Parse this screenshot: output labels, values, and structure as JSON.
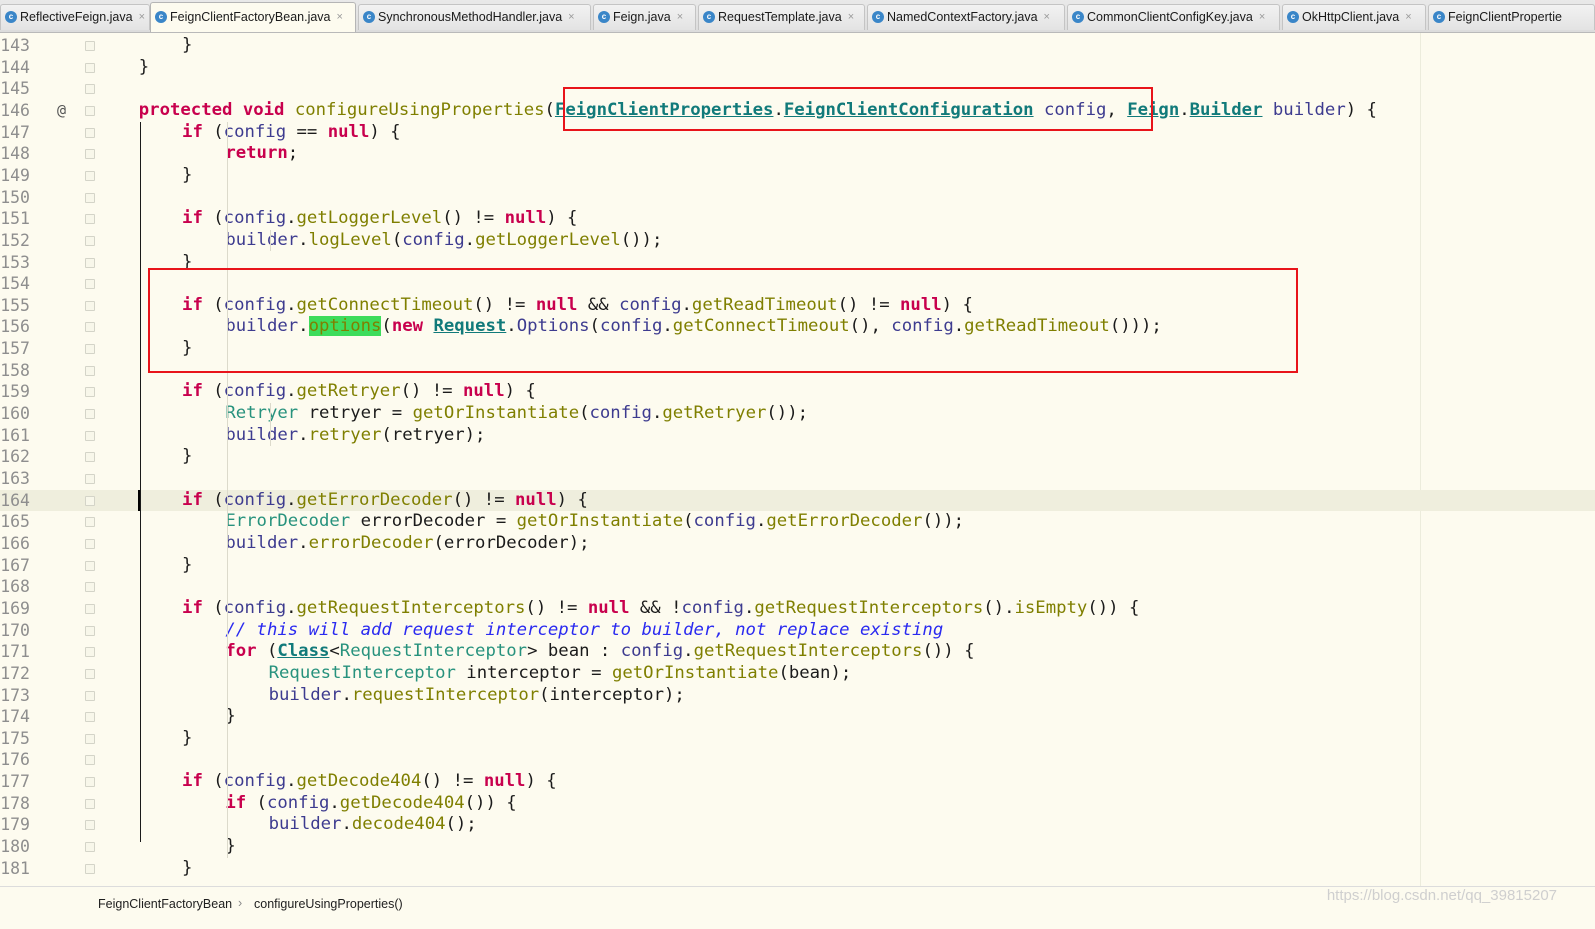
{
  "tabs": [
    {
      "label": "ReflectiveFeign.java",
      "active": false
    },
    {
      "label": "FeignClientFactoryBean.java",
      "active": true
    },
    {
      "label": "SynchronousMethodHandler.java",
      "active": false
    },
    {
      "label": "Feign.java",
      "active": false
    },
    {
      "label": "RequestTemplate.java",
      "active": false
    },
    {
      "label": "NamedContextFactory.java",
      "active": false
    },
    {
      "label": "CommonClientConfigKey.java",
      "active": false
    },
    {
      "label": "OkHttpClient.java",
      "active": false
    },
    {
      "label": "FeignClientPropertie",
      "active": false
    }
  ],
  "tab_icon": "class-icon",
  "tab_icon_glyph": "c",
  "tab_close_glyph": "×",
  "gutter": {
    "override_marker": "@",
    "override_marker_line": 146
  },
  "current_line": 164,
  "code_lines": [
    {
      "n": 143,
      "indent": 8,
      "tokens": [
        {
          "t": "}"
        }
      ]
    },
    {
      "n": 144,
      "indent": 4,
      "tokens": [
        {
          "t": "}"
        }
      ]
    },
    {
      "n": 145,
      "indent": 0,
      "tokens": []
    },
    {
      "n": 146,
      "indent": 4,
      "tokens": [
        {
          "t": "protected",
          "c": "kw"
        },
        {
          "t": " "
        },
        {
          "t": "void",
          "c": "kw"
        },
        {
          "t": " "
        },
        {
          "t": "configureUsingProperties",
          "c": "m"
        },
        {
          "t": "("
        },
        {
          "t": "FeignClientProperties",
          "c": "tl"
        },
        {
          "t": "."
        },
        {
          "t": "FeignClientConfiguration",
          "c": "tl"
        },
        {
          "t": " "
        },
        {
          "t": "config",
          "c": "v"
        },
        {
          "t": ", "
        },
        {
          "t": "Feign",
          "c": "tl"
        },
        {
          "t": "."
        },
        {
          "t": "Builder",
          "c": "tl"
        },
        {
          "t": " "
        },
        {
          "t": "builder",
          "c": "v"
        },
        {
          "t": ") {"
        }
      ]
    },
    {
      "n": 147,
      "indent": 8,
      "tokens": [
        {
          "t": "if",
          "c": "kw"
        },
        {
          "t": " ("
        },
        {
          "t": "config",
          "c": "v"
        },
        {
          "t": " == "
        },
        {
          "t": "null",
          "c": "kw"
        },
        {
          "t": ") {"
        }
      ]
    },
    {
      "n": 148,
      "indent": 12,
      "tokens": [
        {
          "t": "return",
          "c": "kw"
        },
        {
          "t": ";"
        }
      ]
    },
    {
      "n": 149,
      "indent": 8,
      "tokens": [
        {
          "t": "}"
        }
      ]
    },
    {
      "n": 150,
      "indent": 0,
      "tokens": []
    },
    {
      "n": 151,
      "indent": 8,
      "tokens": [
        {
          "t": "if",
          "c": "kw"
        },
        {
          "t": " ("
        },
        {
          "t": "config",
          "c": "v"
        },
        {
          "t": "."
        },
        {
          "t": "getLoggerLevel",
          "c": "m"
        },
        {
          "t": "() != "
        },
        {
          "t": "null",
          "c": "kw"
        },
        {
          "t": ") {"
        }
      ]
    },
    {
      "n": 152,
      "indent": 12,
      "tokens": [
        {
          "t": "builder",
          "c": "v"
        },
        {
          "t": "."
        },
        {
          "t": "logLevel",
          "c": "m"
        },
        {
          "t": "("
        },
        {
          "t": "config",
          "c": "v"
        },
        {
          "t": "."
        },
        {
          "t": "getLoggerLevel",
          "c": "m"
        },
        {
          "t": "());"
        }
      ]
    },
    {
      "n": 153,
      "indent": 8,
      "tokens": [
        {
          "t": "}"
        }
      ]
    },
    {
      "n": 154,
      "indent": 0,
      "tokens": []
    },
    {
      "n": 155,
      "indent": 8,
      "tokens": [
        {
          "t": "if",
          "c": "kw"
        },
        {
          "t": " ("
        },
        {
          "t": "config",
          "c": "v"
        },
        {
          "t": "."
        },
        {
          "t": "getConnectTimeout",
          "c": "m"
        },
        {
          "t": "() != "
        },
        {
          "t": "null",
          "c": "kw"
        },
        {
          "t": " && "
        },
        {
          "t": "config",
          "c": "v"
        },
        {
          "t": "."
        },
        {
          "t": "getReadTimeout",
          "c": "m"
        },
        {
          "t": "() != "
        },
        {
          "t": "null",
          "c": "kw"
        },
        {
          "t": ") {"
        }
      ]
    },
    {
      "n": 156,
      "indent": 12,
      "tokens": [
        {
          "t": "builder",
          "c": "v"
        },
        {
          "t": "."
        },
        {
          "t": "options",
          "c": "m hl"
        },
        {
          "t": "("
        },
        {
          "t": "new",
          "c": "kw"
        },
        {
          "t": " "
        },
        {
          "t": "Request",
          "c": "tl"
        },
        {
          "t": "."
        },
        {
          "t": "Options",
          "c": "v"
        },
        {
          "t": "("
        },
        {
          "t": "config",
          "c": "v"
        },
        {
          "t": "."
        },
        {
          "t": "getConnectTimeout",
          "c": "m"
        },
        {
          "t": "(), "
        },
        {
          "t": "config",
          "c": "v"
        },
        {
          "t": "."
        },
        {
          "t": "getReadTimeout",
          "c": "m"
        },
        {
          "t": "()));"
        }
      ]
    },
    {
      "n": 157,
      "indent": 8,
      "tokens": [
        {
          "t": "}"
        }
      ]
    },
    {
      "n": 158,
      "indent": 0,
      "tokens": []
    },
    {
      "n": 159,
      "indent": 8,
      "tokens": [
        {
          "t": "if",
          "c": "kw"
        },
        {
          "t": " ("
        },
        {
          "t": "config",
          "c": "v"
        },
        {
          "t": "."
        },
        {
          "t": "getRetryer",
          "c": "m"
        },
        {
          "t": "() != "
        },
        {
          "t": "null",
          "c": "kw"
        },
        {
          "t": ") {"
        }
      ]
    },
    {
      "n": 160,
      "indent": 12,
      "tokens": [
        {
          "t": "Retryer",
          "c": "t"
        },
        {
          "t": " retryer = "
        },
        {
          "t": "getOrInstantiate",
          "c": "m"
        },
        {
          "t": "("
        },
        {
          "t": "config",
          "c": "v"
        },
        {
          "t": "."
        },
        {
          "t": "getRetryer",
          "c": "m"
        },
        {
          "t": "());"
        }
      ]
    },
    {
      "n": 161,
      "indent": 12,
      "tokens": [
        {
          "t": "builder",
          "c": "v"
        },
        {
          "t": "."
        },
        {
          "t": "retryer",
          "c": "m"
        },
        {
          "t": "(retryer);"
        }
      ]
    },
    {
      "n": 162,
      "indent": 8,
      "tokens": [
        {
          "t": "}"
        }
      ]
    },
    {
      "n": 163,
      "indent": 0,
      "tokens": []
    },
    {
      "n": 164,
      "indent": 8,
      "tokens": [
        {
          "t": "if",
          "c": "kw"
        },
        {
          "t": " ("
        },
        {
          "t": "config",
          "c": "v"
        },
        {
          "t": "."
        },
        {
          "t": "getErrorDecoder",
          "c": "m"
        },
        {
          "t": "() != "
        },
        {
          "t": "null",
          "c": "kw"
        },
        {
          "t": ") {"
        }
      ]
    },
    {
      "n": 165,
      "indent": 12,
      "tokens": [
        {
          "t": "ErrorDecoder",
          "c": "t"
        },
        {
          "t": " errorDecoder = "
        },
        {
          "t": "getOrInstantiate",
          "c": "m"
        },
        {
          "t": "("
        },
        {
          "t": "config",
          "c": "v"
        },
        {
          "t": "."
        },
        {
          "t": "getErrorDecoder",
          "c": "m"
        },
        {
          "t": "());"
        }
      ]
    },
    {
      "n": 166,
      "indent": 12,
      "tokens": [
        {
          "t": "builder",
          "c": "v"
        },
        {
          "t": "."
        },
        {
          "t": "errorDecoder",
          "c": "m"
        },
        {
          "t": "(errorDecoder);"
        }
      ]
    },
    {
      "n": 167,
      "indent": 8,
      "tokens": [
        {
          "t": "}"
        }
      ]
    },
    {
      "n": 168,
      "indent": 0,
      "tokens": []
    },
    {
      "n": 169,
      "indent": 8,
      "tokens": [
        {
          "t": "if",
          "c": "kw"
        },
        {
          "t": " ("
        },
        {
          "t": "config",
          "c": "v"
        },
        {
          "t": "."
        },
        {
          "t": "getRequestInterceptors",
          "c": "m"
        },
        {
          "t": "() != "
        },
        {
          "t": "null",
          "c": "kw"
        },
        {
          "t": " && !"
        },
        {
          "t": "config",
          "c": "v"
        },
        {
          "t": "."
        },
        {
          "t": "getRequestInterceptors",
          "c": "m"
        },
        {
          "t": "()."
        },
        {
          "t": "isEmpty",
          "c": "m"
        },
        {
          "t": "()) {"
        }
      ]
    },
    {
      "n": 170,
      "indent": 12,
      "tokens": [
        {
          "t": "// this will add request interceptor to builder, not replace existing",
          "c": "cm"
        }
      ]
    },
    {
      "n": 171,
      "indent": 12,
      "tokens": [
        {
          "t": "for",
          "c": "kw"
        },
        {
          "t": " ("
        },
        {
          "t": "Class",
          "c": "tl"
        },
        {
          "t": "<"
        },
        {
          "t": "RequestInterceptor",
          "c": "t"
        },
        {
          "t": "> bean : "
        },
        {
          "t": "config",
          "c": "v"
        },
        {
          "t": "."
        },
        {
          "t": "getRequestInterceptors",
          "c": "m"
        },
        {
          "t": "()) {"
        }
      ]
    },
    {
      "n": 172,
      "indent": 16,
      "tokens": [
        {
          "t": "RequestInterceptor",
          "c": "t"
        },
        {
          "t": " interceptor = "
        },
        {
          "t": "getOrInstantiate",
          "c": "m"
        },
        {
          "t": "(bean);"
        }
      ]
    },
    {
      "n": 173,
      "indent": 16,
      "tokens": [
        {
          "t": "builder",
          "c": "v"
        },
        {
          "t": "."
        },
        {
          "t": "requestInterceptor",
          "c": "m"
        },
        {
          "t": "(interceptor);"
        }
      ]
    },
    {
      "n": 174,
      "indent": 12,
      "tokens": [
        {
          "t": "}"
        }
      ]
    },
    {
      "n": 175,
      "indent": 8,
      "tokens": [
        {
          "t": "}"
        }
      ]
    },
    {
      "n": 176,
      "indent": 0,
      "tokens": []
    },
    {
      "n": 177,
      "indent": 8,
      "tokens": [
        {
          "t": "if",
          "c": "kw"
        },
        {
          "t": " ("
        },
        {
          "t": "config",
          "c": "v"
        },
        {
          "t": "."
        },
        {
          "t": "getDecode404",
          "c": "m"
        },
        {
          "t": "() != "
        },
        {
          "t": "null",
          "c": "kw"
        },
        {
          "t": ") {"
        }
      ]
    },
    {
      "n": 178,
      "indent": 12,
      "tokens": [
        {
          "t": "if",
          "c": "kw"
        },
        {
          "t": " ("
        },
        {
          "t": "config",
          "c": "v"
        },
        {
          "t": "."
        },
        {
          "t": "getDecode404",
          "c": "m"
        },
        {
          "t": "()) {"
        }
      ]
    },
    {
      "n": 179,
      "indent": 16,
      "tokens": [
        {
          "t": "builder",
          "c": "v"
        },
        {
          "t": "."
        },
        {
          "t": "decode404",
          "c": "m"
        },
        {
          "t": "();"
        }
      ]
    },
    {
      "n": 180,
      "indent": 12,
      "tokens": [
        {
          "t": "}"
        }
      ]
    },
    {
      "n": 181,
      "indent": 8,
      "tokens": [
        {
          "t": "}"
        }
      ]
    }
  ],
  "breadcrumb": [
    "FeignClientFactoryBean",
    "configureUsingProperties()"
  ],
  "breadcrumb_separator": "›",
  "watermark": "https://blog.csdn.net/qq_39815207",
  "colors": {
    "keyword": "#c8004d",
    "method": "#7f7f00",
    "variable": "#3d3b8f",
    "type": "#27927d",
    "type_link": "#117a7a",
    "comment": "#2a2af0",
    "highlight": "#3ddc5c",
    "annotation_box": "#e8141a",
    "editor_bg": "#fdfbef",
    "current_line_bg": "#efeedd"
  }
}
